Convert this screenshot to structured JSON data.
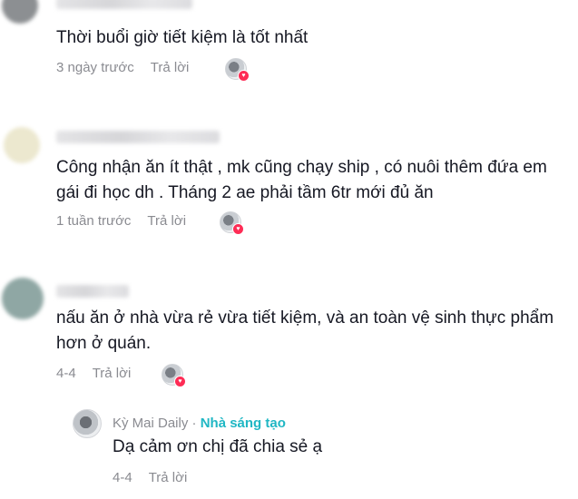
{
  "comments": [
    {
      "text": "Thời buổi giờ tiết kiệm là tốt nhất",
      "time": "3 ngày trước",
      "reply_label": "Trả lời"
    },
    {
      "text": "Công nhận ăn ít thật , mk cũng chạy ship , có nuôi thêm đứa em gái đi học dh . Tháng 2 ae phải tầm 6tr mới đủ ăn",
      "time": "1 tuần trước",
      "reply_label": "Trả lời"
    },
    {
      "text": "nấu ăn ở nhà vừa rẻ vừa tiết kiệm, và an toàn vệ sinh thực phẩm hơn ở quán.",
      "time": "4-4",
      "reply_label": "Trả lời"
    }
  ],
  "reply": {
    "author": "Kỳ Mai Daily",
    "separator": " · ",
    "badge": "Nhà sáng tạo",
    "text": "Dạ cảm ơn chị đã chia sẻ ạ",
    "time": "4-4",
    "reply_label": "Trả lời"
  },
  "icons": {
    "liked_by_creator": "heart-icon"
  },
  "colors": {
    "creator_badge": "#20b7c4",
    "heart": "#fe2c55",
    "meta": "#8a8b91"
  }
}
